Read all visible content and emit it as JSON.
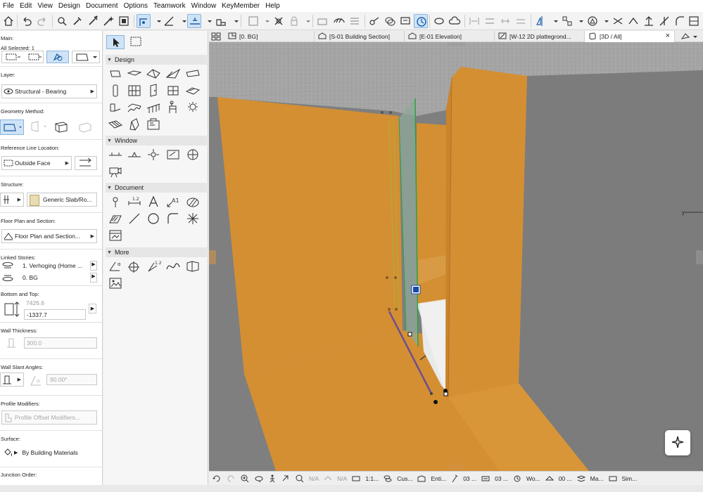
{
  "menu": [
    "File",
    "Edit",
    "View",
    "Design",
    "Document",
    "Options",
    "Teamwork",
    "Window",
    "KeyMember",
    "Help"
  ],
  "infobox": {
    "main_label": "Main:",
    "all_selected": "All Selected: 1",
    "layer_label": "Layer:",
    "layer_value": "Structural - Bearing",
    "geometry_label": "Geometry Method:",
    "refline_label": "Reference Line Location:",
    "refline_value": "Outside Face",
    "structure_label": "Structure:",
    "structure_value": "Generic Slab/Ro...",
    "floorplan_label": "Floor Plan and Section:",
    "floorplan_value": "Floor Plan and Section...",
    "linked_label": "Linked Stories:",
    "linked_top": "1. Verhoging (Home ...",
    "linked_bottom": "0. BG",
    "bottomtop_label": "Bottom and Top:",
    "top_value": "7426.6",
    "bottom_value": "-1337.7",
    "thickness_label": "Wall Thickness:",
    "thickness_value": "300.0",
    "slant_label": "Wall Slant Angles:",
    "slant_value": "90.00°",
    "profile_label": "Profile Modifiers:",
    "profile_value": "Profile Offset Modifiers...",
    "surface_label": "Surface:",
    "surface_value": "By Building Materials",
    "junction_label": "Junction Order:"
  },
  "toolbox": {
    "groups": [
      "Design",
      "Window",
      "Document",
      "More"
    ]
  },
  "tabs": [
    {
      "label": "[0. BG]"
    },
    {
      "label": "[S-01 Building Section]"
    },
    {
      "label": "[E-01 Elevation]"
    },
    {
      "label": "[W-12 2D plattegrond..."
    },
    {
      "label": "[3D / All]"
    }
  ],
  "statusbar": {
    "na1": "N/A",
    "na2": "N/A",
    "scale": "1:1...",
    "custom": "Cus...",
    "entire": "Enti...",
    "s03a": "03 ...",
    "s03b": "03 ...",
    "wo": "Wo...",
    "s00": "00 ...",
    "ma": "Ma...",
    "sim": "Sim..."
  },
  "colors": {
    "wall": "#d48f33",
    "ceiling": "#a6a6a6",
    "glass": "#8fa89a",
    "accent": "#1a6fc9"
  }
}
